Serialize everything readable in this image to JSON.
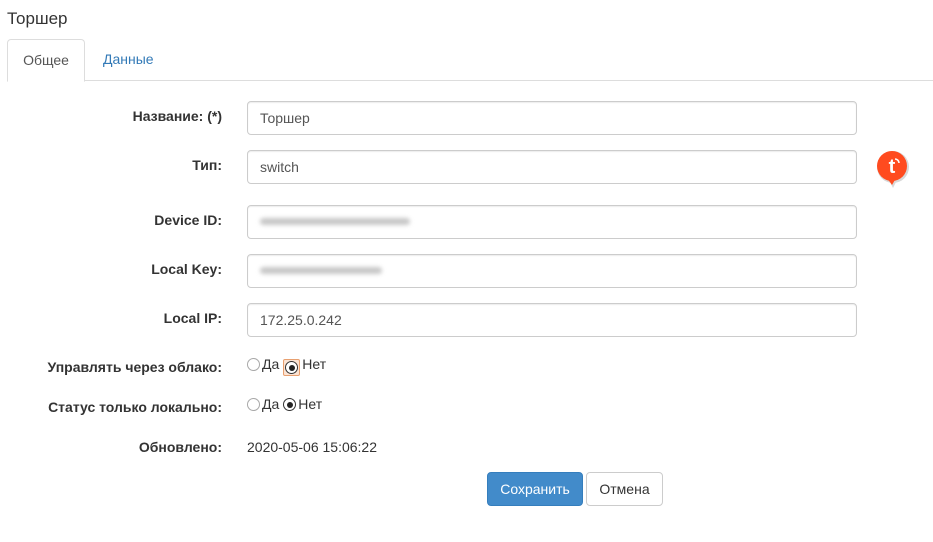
{
  "page": {
    "title": "Торшер"
  },
  "tabs": [
    {
      "label": "Общее",
      "active": true
    },
    {
      "label": "Данные",
      "active": false
    }
  ],
  "form": {
    "name": {
      "label": "Название: (*)",
      "value": "Торшер"
    },
    "type": {
      "label": "Тип:",
      "value": "switch"
    },
    "device_id": {
      "label": "Device ID:",
      "value": ""
    },
    "local_key": {
      "label": "Local Key:",
      "value": ""
    },
    "local_ip": {
      "label": "Local IP:",
      "value": "172.25.0.242"
    },
    "cloud_control": {
      "label": "Управлять через облако:",
      "options": [
        "Да",
        "Нет"
      ],
      "selected": "Нет"
    },
    "local_status_only": {
      "label": "Статус только локально:",
      "options": [
        "Да",
        "Нет"
      ],
      "selected": "Нет"
    },
    "updated": {
      "label": "Обновлено:",
      "value": "2020-05-06 15:06:22"
    }
  },
  "buttons": {
    "save": "Сохранить",
    "cancel": "Отмена"
  },
  "icons": {
    "device_type": "tuya-logo-icon"
  },
  "colors": {
    "primary": "#428bca",
    "link": "#337ab7",
    "tuya": "#ff4b1f"
  }
}
